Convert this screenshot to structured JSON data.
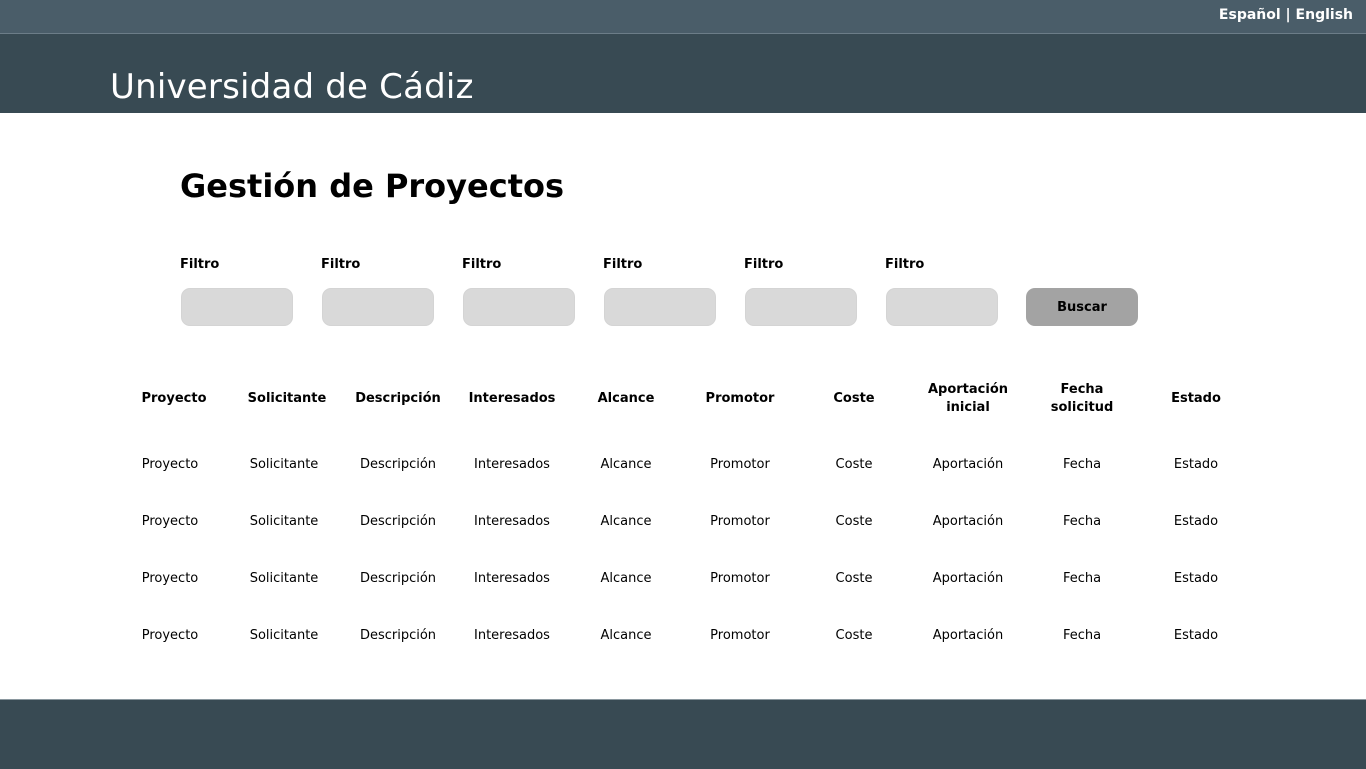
{
  "topbar": {
    "lang_es": "Español",
    "separator": "|",
    "lang_en": "English"
  },
  "header": {
    "site_title": "Universidad de Cádiz"
  },
  "main": {
    "title": "Gestión de Proyectos",
    "filters": [
      {
        "label": "Filtro",
        "value": ""
      },
      {
        "label": "Filtro",
        "value": ""
      },
      {
        "label": "Filtro",
        "value": ""
      },
      {
        "label": "Filtro",
        "value": ""
      },
      {
        "label": "Filtro",
        "value": ""
      },
      {
        "label": "Filtro",
        "value": ""
      }
    ],
    "search_label": "Buscar"
  },
  "table": {
    "headers": [
      [
        "Proyecto"
      ],
      [
        "Solicitante"
      ],
      [
        "Descripción"
      ],
      [
        "Interesados"
      ],
      [
        "Alcance"
      ],
      [
        "Promotor"
      ],
      [
        "Coste"
      ],
      [
        "Aportación",
        "inicial"
      ],
      [
        "Fecha",
        "solicitud"
      ],
      [
        "Estado"
      ]
    ],
    "rows": [
      [
        "Proyecto",
        "Solicitante",
        "Descripción",
        "Interesados",
        "Alcance",
        "Promotor",
        "Coste",
        "Aportación",
        "Fecha",
        "Estado"
      ],
      [
        "Proyecto",
        "Solicitante",
        "Descripción",
        "Interesados",
        "Alcance",
        "Promotor",
        "Coste",
        "Aportación",
        "Fecha",
        "Estado"
      ],
      [
        "Proyecto",
        "Solicitante",
        "Descripción",
        "Interesados",
        "Alcance",
        "Promotor",
        "Coste",
        "Aportación",
        "Fecha",
        "Estado"
      ],
      [
        "Proyecto",
        "Solicitante",
        "Descripción",
        "Interesados",
        "Alcance",
        "Promotor",
        "Coste",
        "Aportación",
        "Fecha",
        "Estado"
      ]
    ]
  },
  "colors": {
    "topbar": "#4a5d69",
    "header": "#384a53",
    "input": "#d9d9d9",
    "button": "#a3a3a3"
  }
}
